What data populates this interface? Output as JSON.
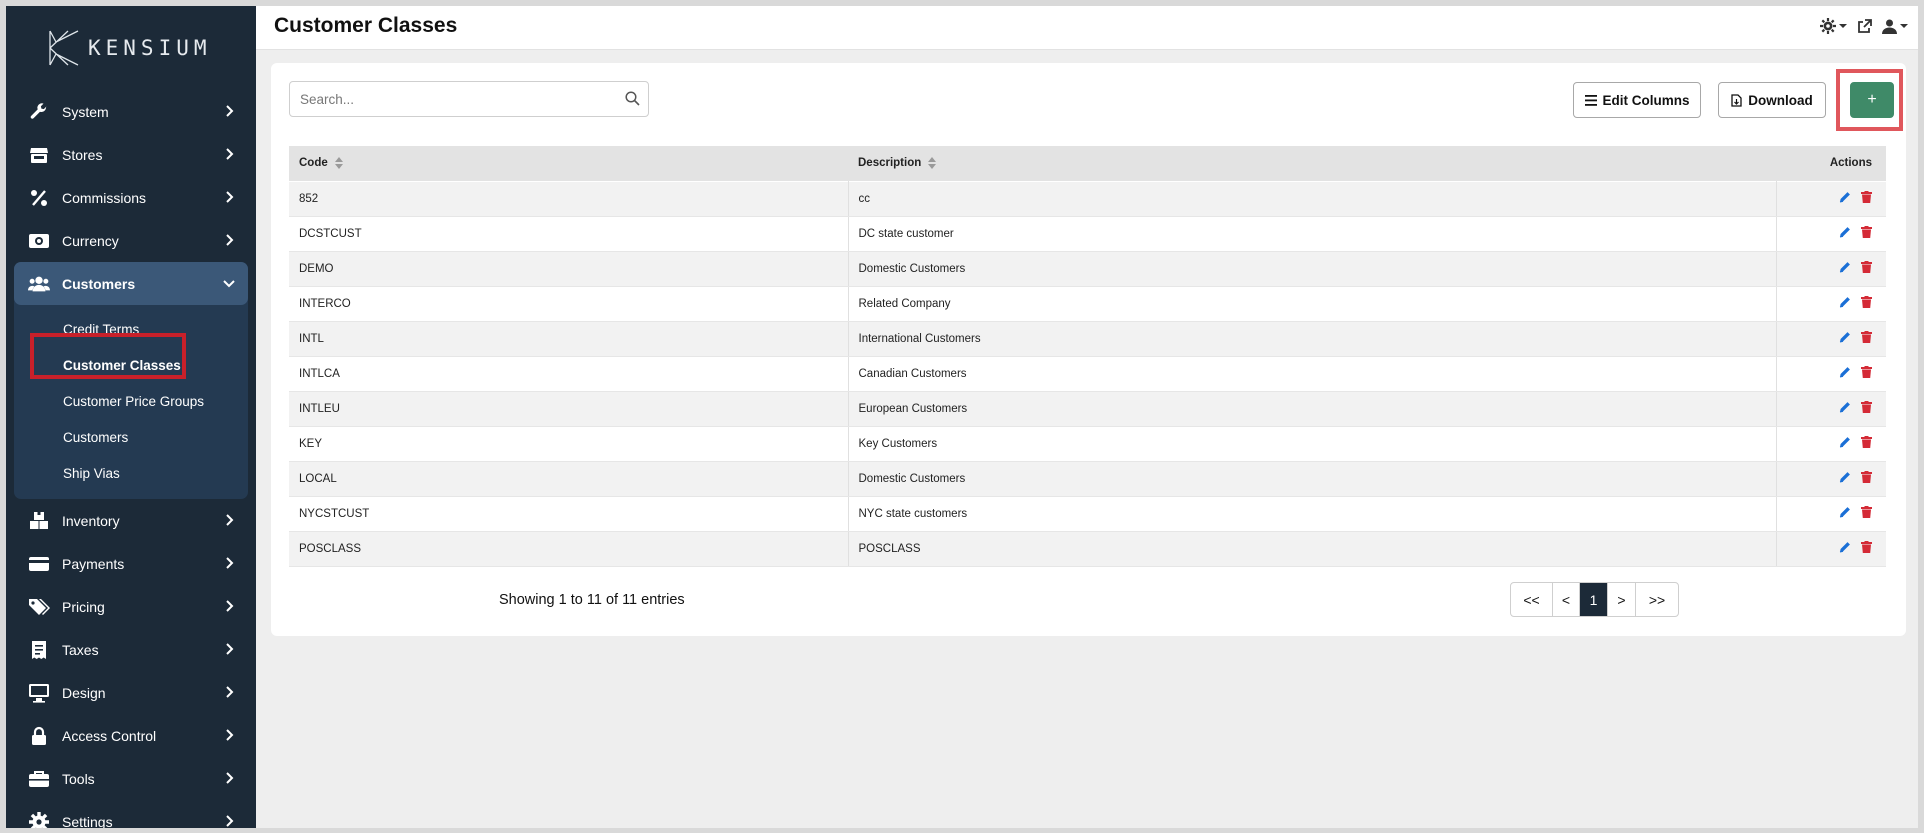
{
  "brand": {
    "name": "KENSIUM"
  },
  "nav": {
    "items_top": [
      {
        "label": "System",
        "icon": "wrench-icon"
      },
      {
        "label": "Stores",
        "icon": "store-icon"
      },
      {
        "label": "Commissions",
        "icon": "percent-icon"
      },
      {
        "label": "Currency",
        "icon": "money-icon"
      }
    ],
    "active_group": {
      "label": "Customers",
      "icon": "users-icon",
      "children": [
        "Credit Terms",
        "Customer Classes",
        "Customer Price Groups",
        "Customers",
        "Ship Vias"
      ],
      "current": "Customer Classes"
    },
    "items_bottom": [
      {
        "label": "Inventory",
        "icon": "boxes-icon"
      },
      {
        "label": "Payments",
        "icon": "credit-card-icon"
      },
      {
        "label": "Pricing",
        "icon": "tags-icon"
      },
      {
        "label": "Taxes",
        "icon": "receipt-icon"
      },
      {
        "label": "Design",
        "icon": "monitor-icon"
      },
      {
        "label": "Access Control",
        "icon": "lock-icon"
      },
      {
        "label": "Tools",
        "icon": "toolbox-icon"
      },
      {
        "label": "Settings",
        "icon": "gear-icon"
      }
    ]
  },
  "header": {
    "title": "Customer Classes"
  },
  "toolbar": {
    "search_placeholder": "Search...",
    "edit_columns_label": "Edit Columns",
    "download_label": "Download",
    "add_label": "+"
  },
  "table": {
    "columns": {
      "code": "Code",
      "description": "Description",
      "actions": "Actions"
    },
    "rows": [
      {
        "code": "852",
        "description": "cc"
      },
      {
        "code": "DCSTCUST",
        "description": "DC state customer"
      },
      {
        "code": "DEMO",
        "description": "Domestic Customers"
      },
      {
        "code": "INTERCO",
        "description": "Related Company"
      },
      {
        "code": "INTL",
        "description": "International Customers"
      },
      {
        "code": "INTLCA",
        "description": "Canadian Customers"
      },
      {
        "code": "INTLEU",
        "description": "European Customers"
      },
      {
        "code": "KEY",
        "description": "Key Customers"
      },
      {
        "code": "LOCAL",
        "description": "Domestic Customers"
      },
      {
        "code": "NYCSTCUST",
        "description": "NYC state customers"
      },
      {
        "code": "POSCLASS",
        "description": "POSCLASS"
      }
    ]
  },
  "footer": {
    "entries_text": "Showing 1 to 11 of 11 entries"
  },
  "pagination": {
    "first": "<<",
    "prev": "<",
    "current": "1",
    "next": ">",
    "last": ">>"
  },
  "colors": {
    "sidebar": "#1c2a38",
    "active_group": "#243a52",
    "add_button": "#3f8a68",
    "edit": "#1a6fd6",
    "delete": "#d42a36",
    "highlight": "#c8202a"
  }
}
